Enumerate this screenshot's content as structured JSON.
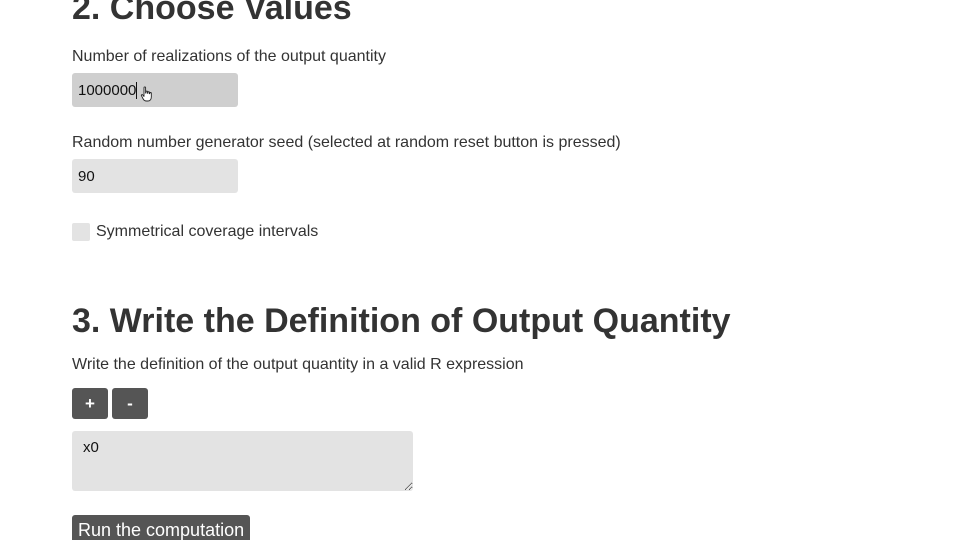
{
  "section2": {
    "heading": "2. Choose Values",
    "realizations_label": "Number of realizations of the output quantity",
    "realizations_value": "1000000",
    "seed_label": "Random number generator seed (selected at random reset button is pressed)",
    "seed_value": "90",
    "symmetric_label": "Symmetrical coverage intervals",
    "symmetric_checked": false
  },
  "section3": {
    "heading": "3. Write the Definition of Output Quantity",
    "description": "Write the definition of the output quantity in a valid R expression",
    "add_label": "+",
    "remove_label": "-",
    "expression_value": "x0",
    "run_label": "Run the computation"
  },
  "cursor": "hand-pointer-icon"
}
